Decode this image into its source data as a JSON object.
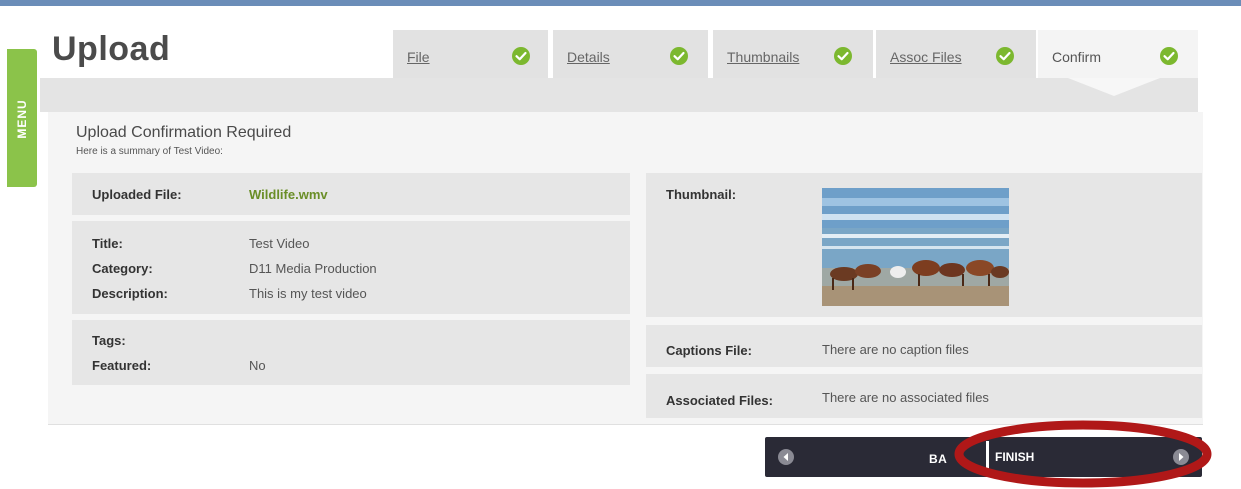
{
  "sidebar": {
    "menu_label": "MENU"
  },
  "header": {
    "title": "Upload"
  },
  "tabs": [
    {
      "label": "File",
      "done": true
    },
    {
      "label": "Details",
      "done": true
    },
    {
      "label": "Thumbnails",
      "done": true
    },
    {
      "label": "Assoc Files",
      "done": true
    },
    {
      "label": "Confirm",
      "done": true,
      "active": true
    }
  ],
  "confirmation": {
    "title": "Upload Confirmation Required",
    "subtitle": "Here is a summary of Test Video:"
  },
  "summary": {
    "uploaded_file_label": "Uploaded File:",
    "uploaded_file_value": "Wildlife.wmv",
    "title_label": "Title:",
    "title_value": "Test Video",
    "category_label": "Category:",
    "category_value": "D11 Media Production",
    "description_label": "Description:",
    "description_value": "This is my test video",
    "tags_label": "Tags:",
    "tags_value": "",
    "featured_label": "Featured:",
    "featured_value": "No",
    "thumbnail_label": "Thumbnail:",
    "captions_label": "Captions File:",
    "captions_value": "There are no caption files",
    "assoc_label": "Associated Files:",
    "assoc_value": "There are no associated files"
  },
  "nav": {
    "back_label": "BA",
    "finish_label": "FINISH"
  },
  "colors": {
    "accent_green": "#8bc34a",
    "check_green": "#7cb82f",
    "nav_bg": "#2a2a36",
    "highlight_red": "#b01818"
  }
}
